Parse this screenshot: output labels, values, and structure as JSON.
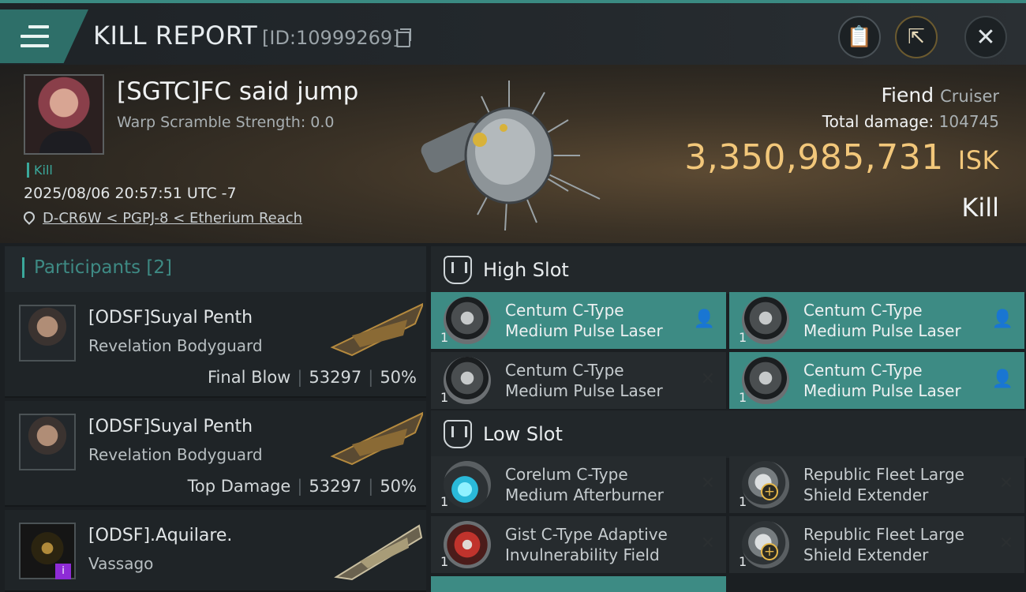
{
  "header": {
    "title": "KILL REPORT",
    "report_id": "[ID:10999269]"
  },
  "victim": {
    "name": "[SGTC]FC said jump",
    "warp_scramble": "Warp Scramble Strength: 0.0",
    "tag": "Kill",
    "datetime": "2025/08/06 20:57:51 UTC -7",
    "location": "D-CR6W < PGPJ-8 < Etherium Reach",
    "ship_name": "Fiend",
    "ship_class": "Cruiser",
    "total_damage_label": "Total damage:",
    "total_damage_value": "104745",
    "isk_value": "3,350,985,731",
    "isk_unit": "ISK",
    "result": "Kill"
  },
  "participants": {
    "title": "Participants",
    "count": "[2]",
    "items": [
      {
        "name": "[ODSF]Suyal Penth",
        "ship": "Revelation Bodyguard",
        "label": "Final Blow",
        "damage": "53297",
        "percent": "50%"
      },
      {
        "name": "[ODSF]Suyal Penth",
        "ship": "Revelation Bodyguard",
        "label": "Top Damage",
        "damage": "53297",
        "percent": "50%"
      },
      {
        "name": "[ODSF].Aquilare.",
        "ship": "Vassago",
        "badge": "i"
      }
    ]
  },
  "fitting": {
    "high_slot_label": "High Slot",
    "low_slot_label": "Low Slot",
    "high": [
      {
        "line1": "Centum C-Type",
        "line2": "Medium Pulse Laser",
        "qty": "1",
        "state": "dropped",
        "icon": "laser-icon"
      },
      {
        "line1": "Centum C-Type",
        "line2": "Medium Pulse Laser",
        "qty": "1",
        "state": "dropped",
        "icon": "laser-icon"
      },
      {
        "line1": "Centum C-Type",
        "line2": "Medium Pulse Laser",
        "qty": "1",
        "state": "destroyed",
        "icon": "laser-icon"
      },
      {
        "line1": "Centum C-Type",
        "line2": "Medium Pulse Laser",
        "qty": "1",
        "state": "dropped",
        "icon": "laser-icon"
      }
    ],
    "low": [
      {
        "line1": "Corelum C-Type",
        "line2": "Medium Afterburner",
        "qty": "1",
        "state": "destroyed",
        "icon": "afterburner-icon"
      },
      {
        "line1": "Republic Fleet Large",
        "line2": "Shield Extender",
        "qty": "1",
        "state": "destroyed",
        "icon": "shield-extender-icon"
      },
      {
        "line1": "Gist C-Type Adaptive",
        "line2": "Invulnerability Field",
        "qty": "1",
        "state": "destroyed",
        "icon": "invulnerability-field-icon"
      },
      {
        "line1": "Republic Fleet Large",
        "line2": "Shield Extender",
        "qty": "1",
        "state": "destroyed",
        "icon": "shield-extender-icon"
      }
    ]
  },
  "colors": {
    "accent": "#3aa89b",
    "isk": "#f2c77a",
    "dropped_bg": "#3d8b84"
  }
}
